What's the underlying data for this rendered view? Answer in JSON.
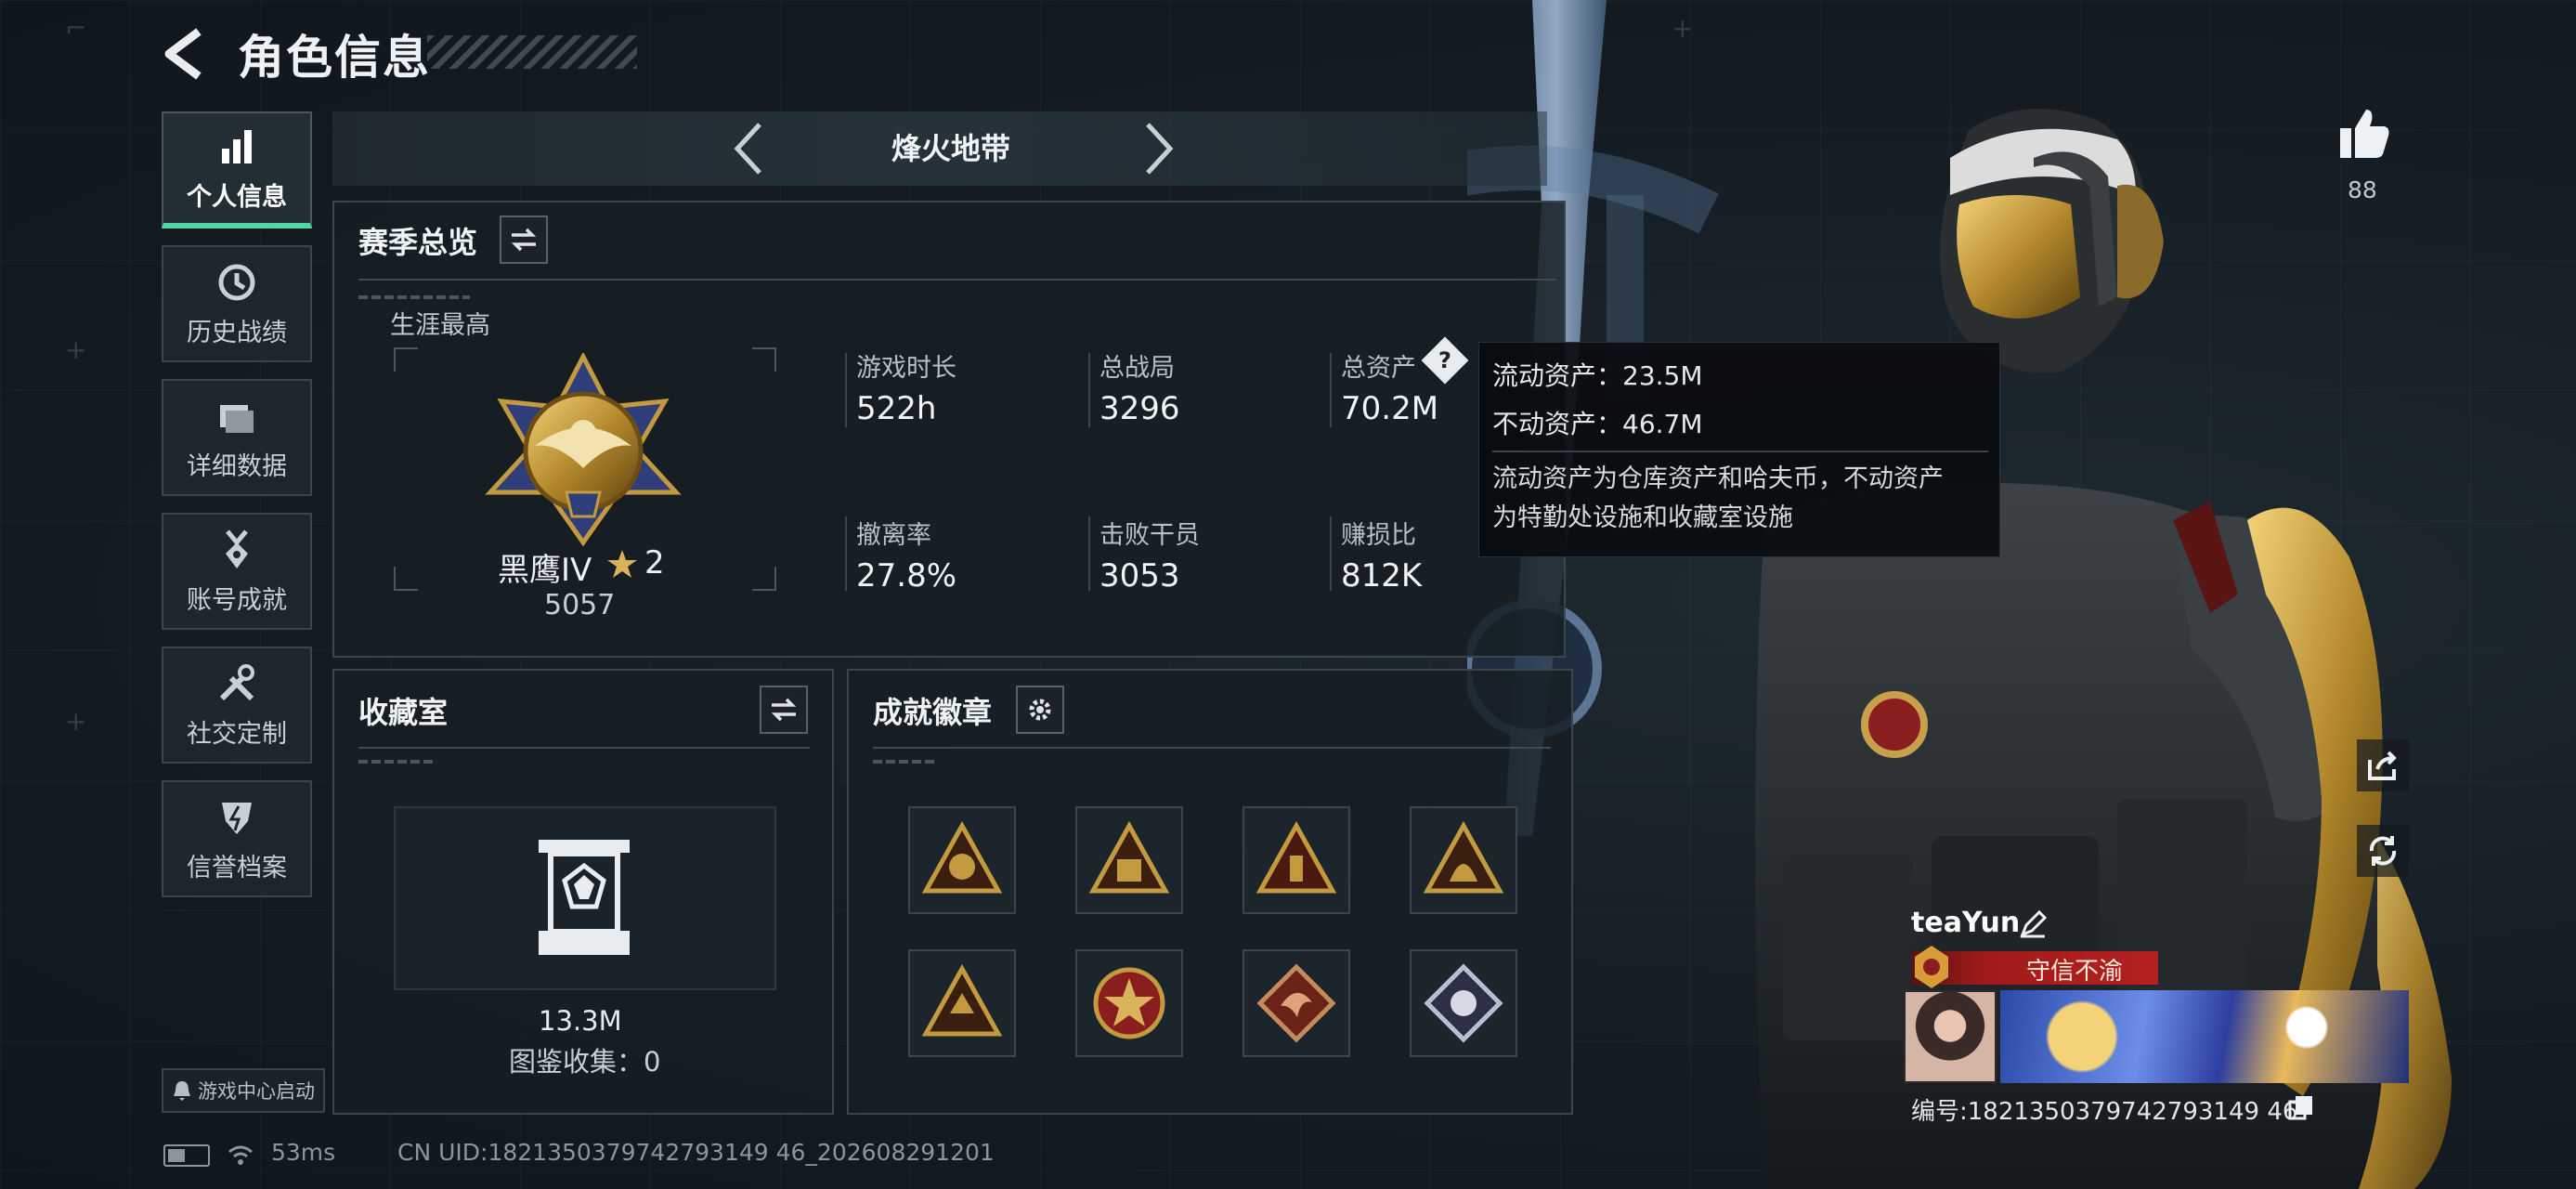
{
  "header": {
    "title": "角色信息"
  },
  "sidebar": {
    "items": [
      {
        "label": "个人信息",
        "icon": "bar-chart-icon",
        "active": true
      },
      {
        "label": "历史战绩",
        "icon": "history-icon",
        "active": false
      },
      {
        "label": "详细数据",
        "icon": "folder-icon",
        "active": false
      },
      {
        "label": "账号成就",
        "icon": "medal-icon",
        "active": false
      },
      {
        "label": "社交定制",
        "icon": "tools-icon",
        "active": false
      },
      {
        "label": "信誉档案",
        "icon": "shield-icon",
        "active": false
      }
    ],
    "game_center": "游戏中心启动"
  },
  "status": {
    "ping": "53ms",
    "uid": "CN UID:1821350379742793149 46_202608291201"
  },
  "mode": {
    "title": "烽火地带"
  },
  "season": {
    "title": "赛季总览",
    "career_label": "生涯最高",
    "rank_name": "黑鹰IV",
    "rank_level": "2",
    "rank_score": "5057",
    "stats": [
      {
        "label": "游戏时长",
        "value": "522h"
      },
      {
        "label": "总战局",
        "value": "3296"
      },
      {
        "label": "总资产",
        "value": "70.2M"
      },
      {
        "label": "撤离率",
        "value": "27.8%"
      },
      {
        "label": "击败干员",
        "value": "3053"
      },
      {
        "label": "赚损比",
        "value": "812K"
      }
    ]
  },
  "tooltip": {
    "liquid": "流动资产：23.5M",
    "fixed": "不动资产：46.7M",
    "desc1": "流动资产为仓库资产和哈夫币，不动资产",
    "desc2": "为特勤处设施和收藏室设施"
  },
  "collection": {
    "title": "收藏室",
    "value": "13.3M",
    "count": "图鉴收集：0"
  },
  "achievements": {
    "title": "成就徽章"
  },
  "profile": {
    "likes": "88",
    "name": "teaYun",
    "title_tag": "守信不渝",
    "id": "编号:1821350379742793149 46"
  },
  "colors": {
    "accent": "#4fd8a4",
    "tag_red": "#b42020"
  }
}
